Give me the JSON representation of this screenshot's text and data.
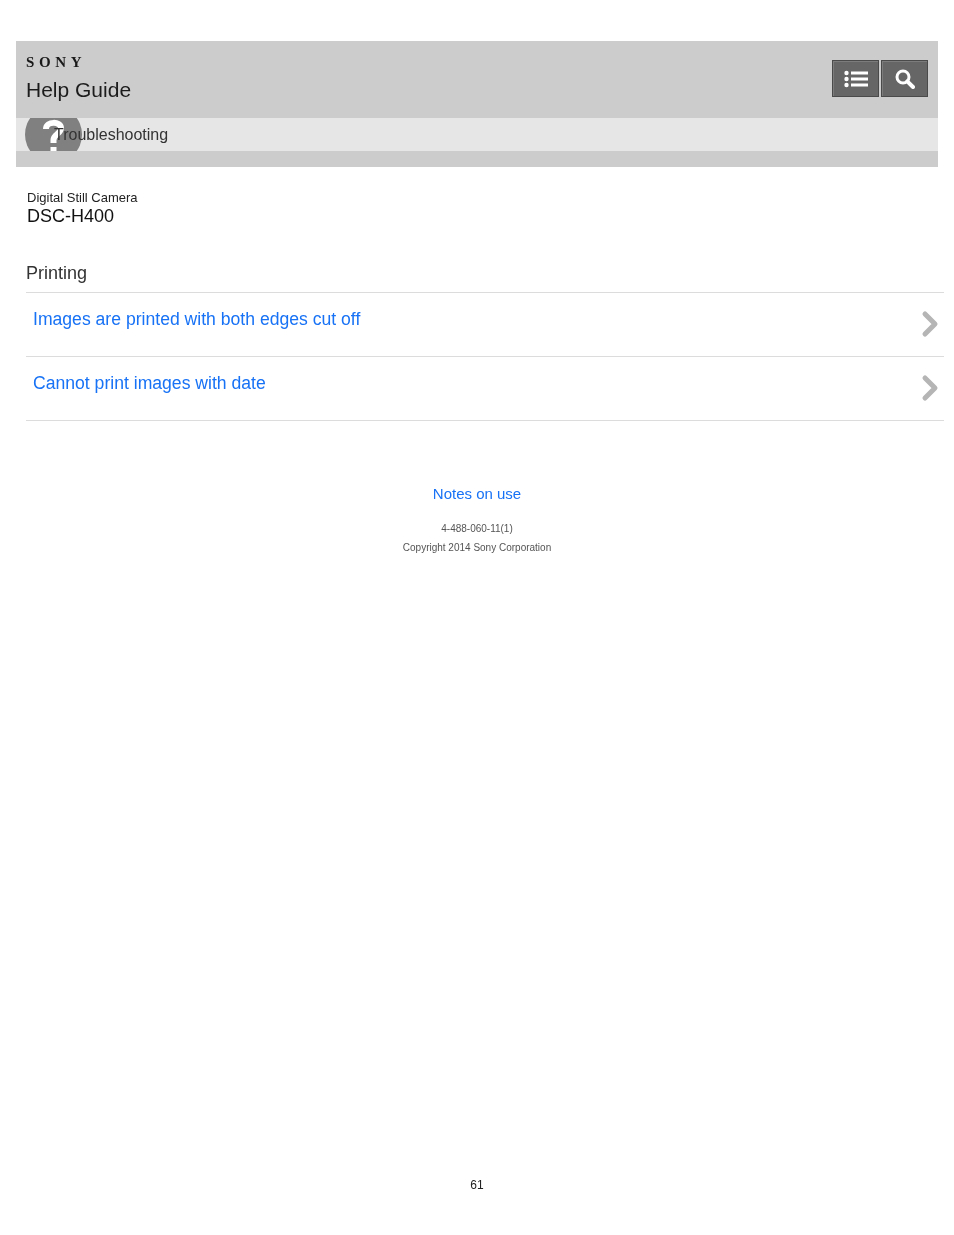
{
  "header": {
    "logo": "SONY",
    "title": "Help Guide"
  },
  "breadcrumb": {
    "label": "Troubleshooting"
  },
  "product": {
    "category": "Digital Still Camera",
    "model": "DSC-H400"
  },
  "section": {
    "title": "Printing",
    "links": [
      {
        "label": "Images are printed with both edges cut off"
      },
      {
        "label": "Cannot print images with date"
      }
    ]
  },
  "footer": {
    "link": "Notes on use",
    "code": "4-488-060-11(1)",
    "copyright": "Copyright 2014 Sony Corporation"
  },
  "page_number": "61"
}
